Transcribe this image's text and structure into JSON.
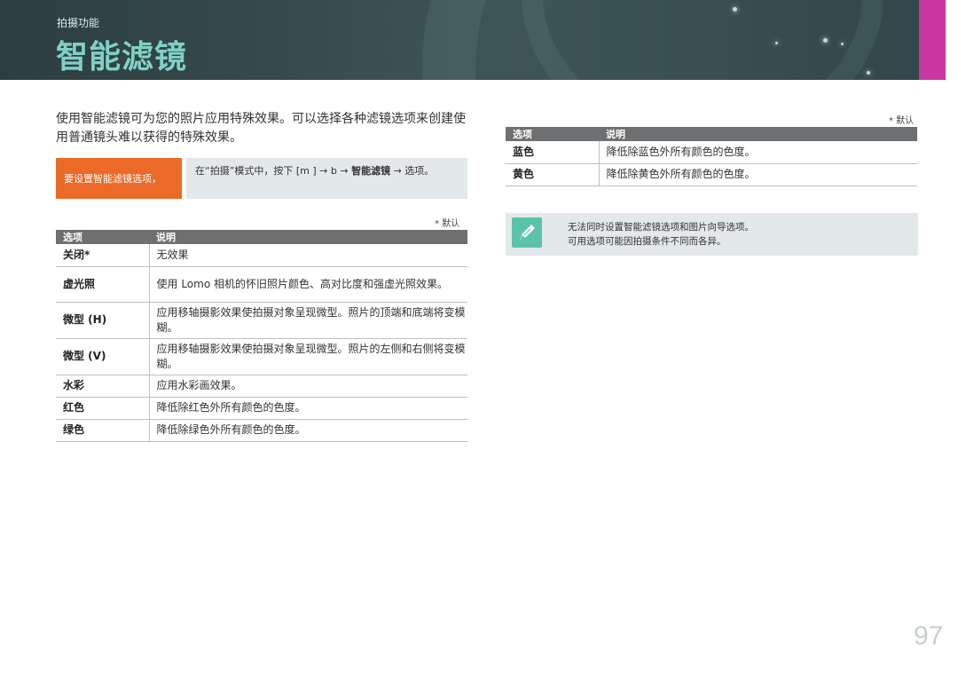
{
  "header": {
    "kicker": "拍摄功能",
    "title": "智能滤镜"
  },
  "intro": {
    "text": "使用智能滤镜可为您的照片应用特殊效果。可以选择各种滤镜选项来创建使用普通镜头难以获得的特殊效果。"
  },
  "howto": {
    "label": "要设置智能滤镜选项，",
    "step_a": "在“拍摄”模式中，按下 [m ] → b → ",
    "step_bold": "智能滤镜",
    "step_b": " → 选项。"
  },
  "default_note": "* 默认",
  "table_headers": {
    "option": "选项",
    "description": "说明"
  },
  "left_table": [
    {
      "option": "关闭*",
      "description": "无效果"
    },
    {
      "option": "虚光照",
      "description": "使用 Lomo 相机的怀旧照片颜色、高对比度和强虚光照效果。"
    },
    {
      "option": "微型 (H)",
      "description": "应用移轴摄影效果使拍摄对象呈现微型。照片的顶端和底端将变模糊。"
    },
    {
      "option": "微型 (V)",
      "description": "应用移轴摄影效果使拍摄对象呈现微型。照片的左侧和右侧将变模糊。"
    },
    {
      "option": "水彩",
      "description": "应用水彩画效果。"
    },
    {
      "option": "红色",
      "description": "降低除红色外所有颜色的色度。"
    },
    {
      "option": "绿色",
      "description": "降低除绿色外所有颜色的色度。"
    }
  ],
  "right_table": [
    {
      "option": "蓝色",
      "description": "降低除蓝色外所有颜色的色度。"
    },
    {
      "option": "黄色",
      "description": "降低除黄色外所有颜色的色度。"
    }
  ],
  "note": {
    "icon": "pen-note-icon",
    "line1": "无法同时设置智能滤镜选项和图片向导选项。",
    "line2": "可用选项可能因拍摄条件不同而各异。"
  },
  "page_number": "97",
  "colors": {
    "banner": "#3e5557",
    "title_accent": "#7fd1c4",
    "magenta_tab": "#c8369f",
    "howto_label": "#ec6a28",
    "table_header": "#6d6f70",
    "note_icon": "#5bc4a8"
  }
}
